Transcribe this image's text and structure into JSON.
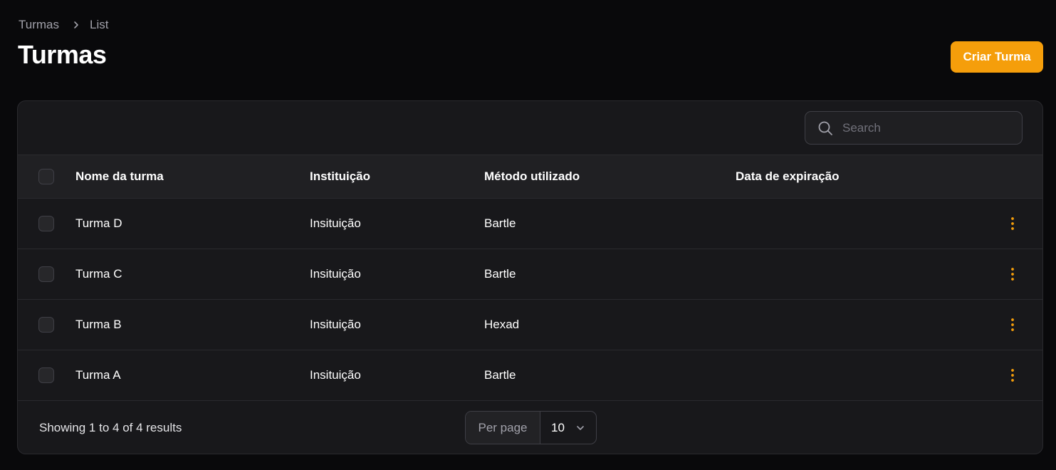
{
  "breadcrumb": {
    "items": [
      "Turmas",
      "List"
    ]
  },
  "page": {
    "title": "Turmas"
  },
  "header": {
    "create_label": "Criar Turma"
  },
  "search": {
    "placeholder": "Search"
  },
  "table": {
    "columns": [
      "Nome da turma",
      "Instituição",
      "Método utilizado",
      "Data de expiração"
    ],
    "rows": [
      {
        "name": "Turma D",
        "institution": "Insituição",
        "method": "Bartle",
        "expiration": ""
      },
      {
        "name": "Turma C",
        "institution": "Insituição",
        "method": "Bartle",
        "expiration": ""
      },
      {
        "name": "Turma B",
        "institution": "Insituição",
        "method": "Hexad",
        "expiration": ""
      },
      {
        "name": "Turma A",
        "institution": "Insituição",
        "method": "Bartle",
        "expiration": ""
      }
    ]
  },
  "footer": {
    "results_text": "Showing 1 to 4 of 4 results",
    "per_page_label": "Per page",
    "per_page_value": "10"
  },
  "icons": {
    "breadcrumb_separator": "chevron-right-icon",
    "search": "search-icon",
    "row_actions": "more-vertical-icon",
    "per_page_dropdown": "chevron-down-icon"
  },
  "colors": {
    "accent": "#f59e0b",
    "background": "#09090b",
    "card": "#18181b",
    "header_row": "#202023"
  }
}
